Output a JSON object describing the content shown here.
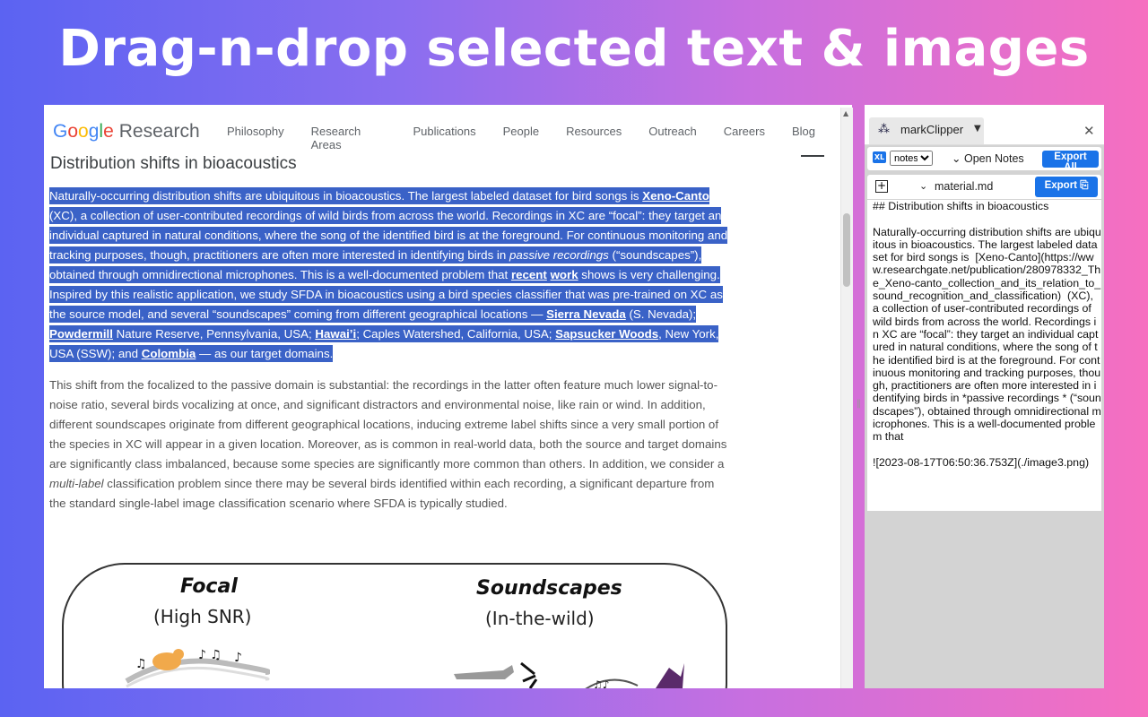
{
  "headline": "Drag-n-drop selected text & images",
  "site": {
    "logo": {
      "g1": "G",
      "g2": "o",
      "g3": "o",
      "g4": "g",
      "g5": "l",
      "g6": "e",
      "research": "Research"
    },
    "nav": [
      "Philosophy",
      "Research Areas",
      "Publications",
      "People",
      "Resources",
      "Outreach",
      "Careers",
      "Blog"
    ],
    "page_title": "Distribution shifts in bioacoustics",
    "para1": {
      "t1": "Naturally-occurring distribution shifts are ubiquitous in bioacoustics. The largest labeled dataset for bird songs is ",
      "link1": "Xeno-Canto",
      "t2": " (XC), a collection of user-contributed recordings of wild birds from across the world. Recordings in XC are “focal”: they target an individual captured in natural conditions, where the song of the identified bird is at the foreground. For continuous monitoring and tracking purposes, though, practitioners are often more interested in identifying birds in ",
      "em1": "passive recordings",
      "t3": " (“soundscapes”), obtained through omnidirectional microphones. This is a well-documented problem that ",
      "link2": "recent",
      "t4": " ",
      "link3": "work",
      "t5": " shows is very challenging. Inspired by this realistic application, we study SFDA in bioacoustics using a bird species classifier that was pre-trained on XC as the source model, and several “soundscapes” coming from different geographical locations — ",
      "link4": "Sierra Nevada",
      "t6": " (S. Nevada); ",
      "link5": "Powdermill",
      "t7": " Nature Reserve, Pennsylvania, USA; ",
      "link6": "Hawai’i",
      "t8": "; Caples Watershed, California, USA; ",
      "link7": "Sapsucker Woods",
      "t9": ", New York, USA (SSW); and ",
      "link8": "Colombia",
      "t10": " — as our target domains."
    },
    "para2": {
      "t1": "This shift from the focalized to the passive domain is substantial: the recordings in the latter often feature much lower signal-to-noise ratio, several birds vocalizing at once, and significant distractors and environmental noise, like rain or wind. In addition, different soundscapes originate from different geographical locations, inducing extreme label shifts since a very small portion of the species in XC will appear in a given location. Moreover, as is common in real-world data, both the source and target domains are significantly class imbalanced, because some species are significantly more common than others. In addition, we consider a ",
      "em1": "multi-label",
      "t2": " classification problem since there may be several birds identified within each recording, a significant departure from the standard single-label image classification scenario where SFDA is typically studied."
    },
    "figure": {
      "left_title": "Focal",
      "left_sub": "(High SNR)",
      "right_title": "Soundscapes",
      "right_sub": "(In-the-wild)"
    }
  },
  "panel": {
    "tab_name": "markClipper",
    "notes_select": "notes",
    "open_notes": "Open Notes",
    "export_all": "Export All",
    "file_name": "material.md",
    "export": "Export",
    "editor_text": "## Distribution shifts in bioacoustics\n\nNaturally-occurring distribution shifts are ubiquitous in bioacoustics. The largest labeled dataset for bird songs is  [Xeno-Canto](https://www.researchgate.net/publication/280978332_The_Xeno-canto_collection_and_its_relation_to_sound_recognition_and_classification)  (XC), a collection of user-contributed recordings of wild birds from across the world. Recordings in XC are “focal”: they target an individual captured in natural conditions, where the song of the identified bird is at the foreground. For continuous monitoring and tracking purposes, though, practitioners are often more interested in identifying birds in *passive recordings * (“soundscapes”), obtained through omnidirectional microphones. This is a well-documented problem that\n\n![2023-08-17T06:50:36.753Z](./image3.png)"
  },
  "colors": {
    "selection": "#3a62c7",
    "accent": "#1a73e8"
  }
}
